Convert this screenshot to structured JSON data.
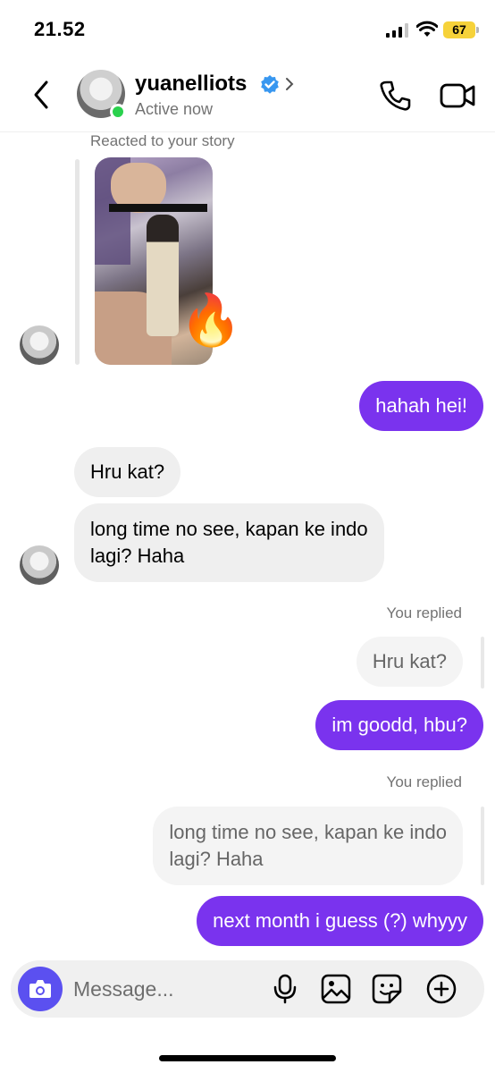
{
  "status_bar": {
    "time": "21.52",
    "battery": "67"
  },
  "header": {
    "username": "yuanelliots",
    "status": "Active now"
  },
  "thread": {
    "story_label": "Reacted to your story",
    "story_reaction": "🔥",
    "messages": [
      {
        "sender": "me",
        "text": "hahah hei!"
      },
      {
        "sender": "them",
        "text": "Hru kat?"
      },
      {
        "sender": "them",
        "lines": [
          "long time no see, kapan ke indo",
          "lagi? Haha"
        ]
      },
      {
        "sender": "me",
        "replied_label": "You replied",
        "quoted": "Hru kat?",
        "text": "im goodd, hbu?"
      },
      {
        "sender": "me",
        "replied_label": "You replied",
        "quoted_lines": [
          "long time no see, kapan ke indo",
          "lagi? Haha"
        ],
        "text": "next month i guess (?) whyyy"
      }
    ]
  },
  "composer": {
    "placeholder": "Message..."
  },
  "colors": {
    "outgoing_bubble": "#7a33ee",
    "camera_button": "#5b50f0",
    "active_dot": "#2ad14d",
    "verified_badge": "#3897f0",
    "battery": "#f6d23a"
  }
}
